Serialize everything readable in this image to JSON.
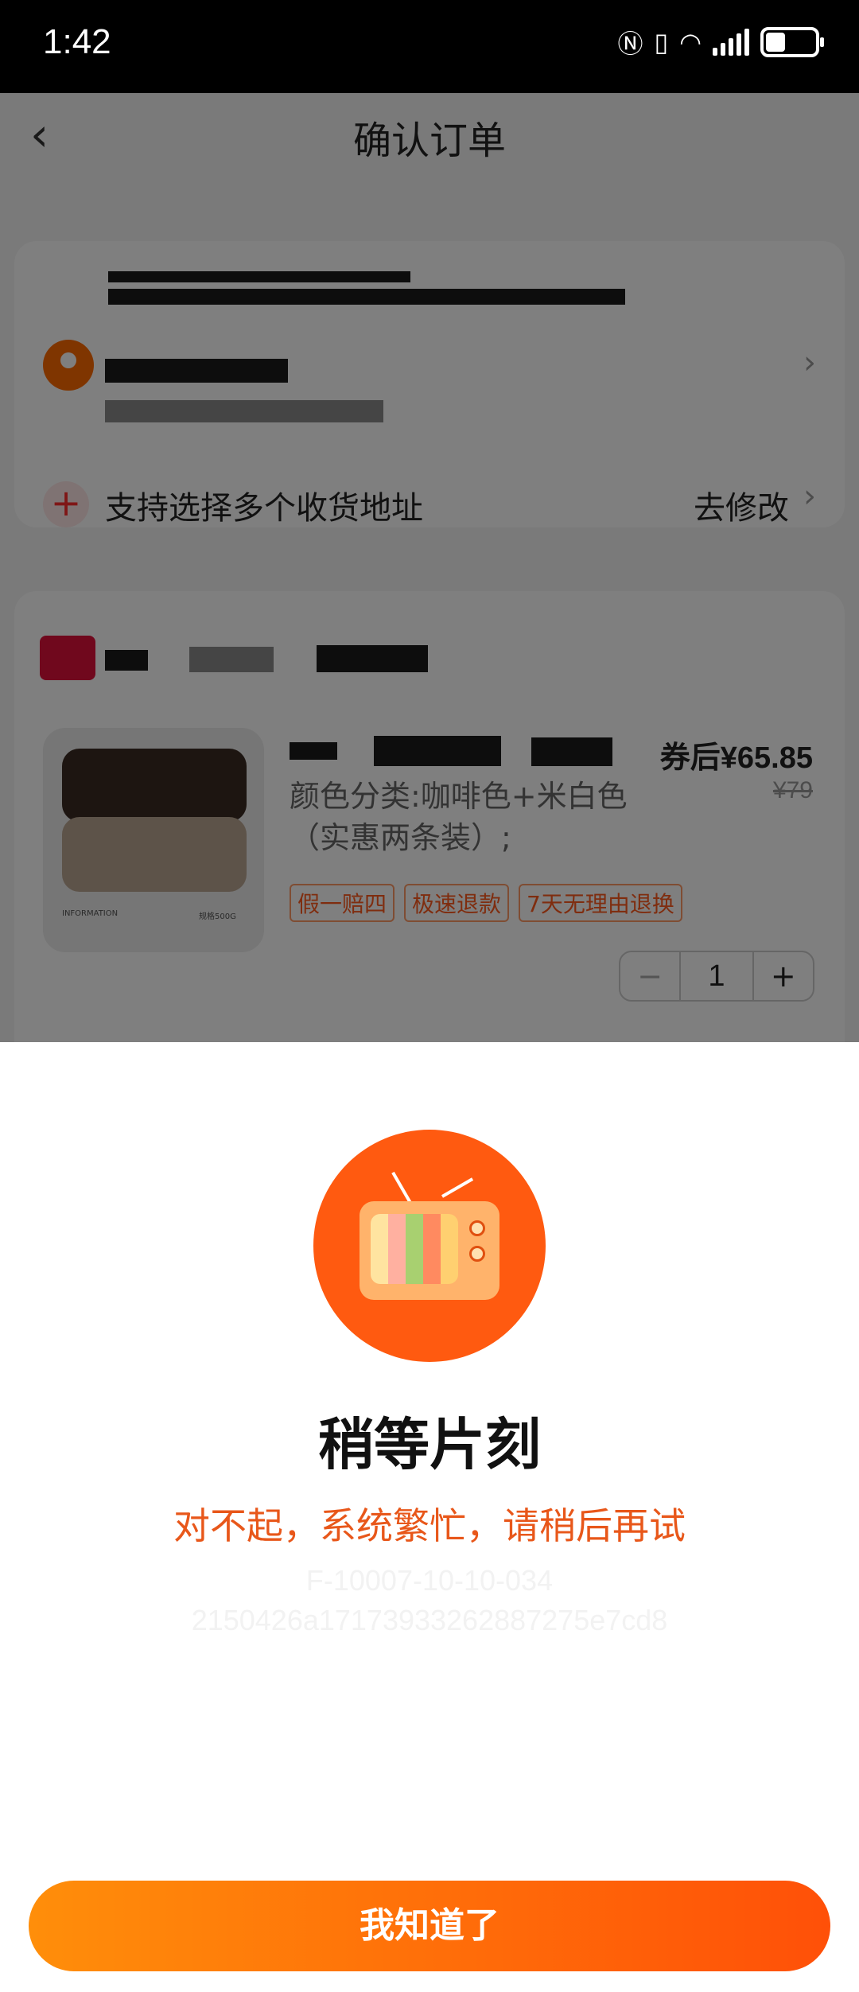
{
  "status_bar": {
    "time": "1:42",
    "icons": [
      "nfc-icon",
      "vibrate-icon",
      "wifi-icon",
      "signal-icon",
      "battery-icon"
    ]
  },
  "nav": {
    "back_icon": "chevron-left-icon",
    "title": "确认订单"
  },
  "address_card": {
    "multi_address_label": "支持选择多个收货地址",
    "modify_label": "去修改"
  },
  "product": {
    "price_label": "券后¥65.85",
    "original_price": "¥79",
    "sku": "颜色分类:咖啡色+米白色（实惠两条装）;",
    "tags": [
      "假一赔四",
      "极速退款",
      "7天无理由退换"
    ],
    "quantity": "1",
    "minus_label": "−",
    "plus_label": "+",
    "image_text": [
      "INFORMATION",
      "规格500G"
    ]
  },
  "dialog": {
    "title": "稍等片刻",
    "message": "对不起，系统繁忙，请稍后再试",
    "error_code": "F-10007-10-10-034",
    "trace_id": "2150426a17173933262887275e7cd8",
    "button_label": "我知道了"
  },
  "colors": {
    "accent": "#ff5a10",
    "message": "#e8571a",
    "button_start": "#ff8e0a",
    "button_end": "#ff5008"
  }
}
